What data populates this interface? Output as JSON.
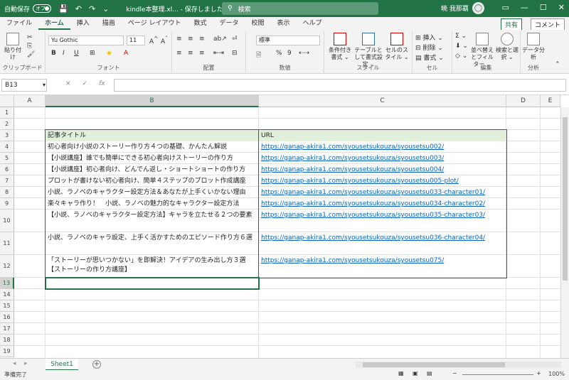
{
  "titlebar": {
    "autosave_label": "自動保存",
    "toggle": "オフ",
    "doc_title": "kindle本整理.xl... - 保存しました ⌄",
    "search": "検索",
    "user": "暁 我那覇",
    "avatar": "◯"
  },
  "menu": [
    "ファイル",
    "ホーム",
    "挿入",
    "描画",
    "ページ レイアウト",
    "数式",
    "データ",
    "校閲",
    "表示",
    "ヘルプ"
  ],
  "share": "共有",
  "comment": "コメント",
  "ribbon": {
    "clipboard": {
      "paste": "貼り付け",
      "label": "クリップボード"
    },
    "font": {
      "name": "Yu Gothic",
      "size": "11",
      "label": "フォント",
      "bold": "B",
      "italic": "I",
      "underline": "U"
    },
    "align": {
      "label": "配置"
    },
    "number": {
      "format": "標準",
      "label": "数値",
      "percent": "%",
      "comma": "9"
    },
    "styles": {
      "cond": "条件付き書式 ⌄",
      "table": "テーブルとして書式設定 ⌄",
      "cell": "セルのスタイル ⌄",
      "label": "スタイル"
    },
    "cells": {
      "insert": "挿入 ⌄",
      "delete": "削除 ⌄",
      "format": "書式 ⌄",
      "label": "セル"
    },
    "edit": {
      "sort": "並べ替えとフィルター ⌄",
      "find": "検索と選択 ⌄",
      "label": "編集"
    },
    "analysis": {
      "data": "データ分析",
      "label": "分析"
    }
  },
  "formula": {
    "namebox": "B13",
    "fx": "fx",
    "cancel": "×",
    "ok": "✓"
  },
  "columns": [
    "A",
    "B",
    "C",
    "D",
    "E"
  ],
  "rows": [
    "1",
    "2",
    "3",
    "4",
    "5",
    "6",
    "7",
    "8",
    "9",
    "10",
    "11",
    "12",
    "13",
    "14",
    "15",
    "16",
    "17",
    "18",
    "19",
    "20",
    "21"
  ],
  "table": {
    "header_title": "記事タイトル",
    "header_url": "URL",
    "rows": [
      {
        "title": "初心者向け小説のストーリー作り方４つの基礎、かんたん解説",
        "url": "https://ganap-akira1.com/syousetsukouza/syousetsu002/"
      },
      {
        "title": "【小説講座】誰でも簡単にできる初心者向けストーリーの作り方",
        "url": "https://ganap-akira1.com/syousetsukouza/syousetsu003/"
      },
      {
        "title": "【小説講座】初心者向け、どんでん返し・ショートショートの作り方",
        "url": "https://ganap-akira1.com/syousetsukouza/syousetsu004/"
      },
      {
        "title": "プロットが書けない初心者向け、簡単４ステップのプロット作成講座",
        "url": "https://ganap-akira1.com/syousetsukouza/syousetsu005-plot/"
      },
      {
        "title": "小説、ラノベのキャラクター設定方法＆あなたが上手くいかない理由",
        "url": "https://ganap-akira1.com/syousetsukouza/syousetsu033-character01/"
      },
      {
        "title": "楽々キャラ作り！　小説、ラノベの魅力的なキャラクター設定方法",
        "url": "https://ganap-akira1.com/syousetsukouza/syousetsu034-character02/"
      },
      {
        "title": "【小説、ラノベのキャラクター設定方法】キャラを立たせる２つの要素",
        "url": "https://ganap-akira1.com/syousetsukouza/syousetsu035-character03/"
      },
      {
        "title": "小説、ラノベのキャラ設定、上手く活かすためのエピソード作り方６選",
        "url": "https://ganap-akira1.com/syousetsukouza/syousetsu036-character04/"
      },
      {
        "title": "「ストーリーが思いつかない」を即解決！アイデアの生み出し方３選【ストーリーの作り方講座】",
        "url": "https://ganap-akira1.com/syousetsukouza/syousetsu075/"
      }
    ]
  },
  "sheet_tab": "Sheet1",
  "status": "準備完了",
  "zoom": "100%"
}
